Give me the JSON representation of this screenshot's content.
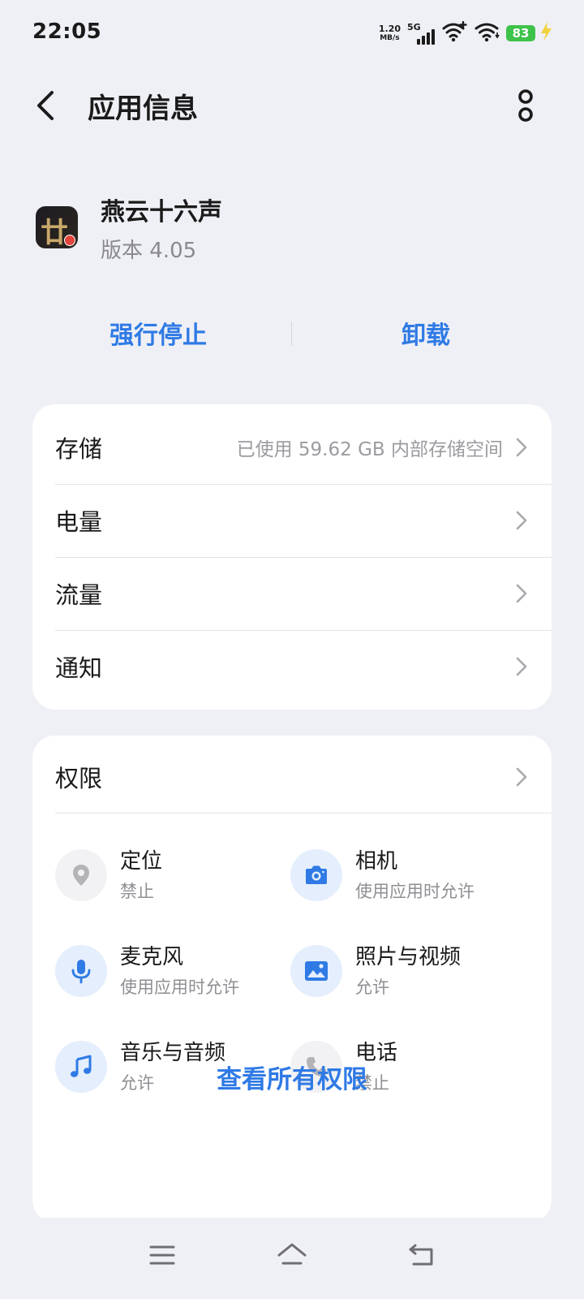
{
  "status_bar": {
    "time": "22:05",
    "net_speed_value": "1.20",
    "net_speed_unit": "MB/s",
    "network_type": "5G",
    "battery": "83",
    "charging": true
  },
  "header": {
    "title": "应用信息"
  },
  "app": {
    "name": "燕云十六声",
    "version": "版本 4.05",
    "icon_glyph": "廿"
  },
  "actions": {
    "force_stop": "强行停止",
    "uninstall": "卸载"
  },
  "settings_list": {
    "storage_label": "存储",
    "storage_value": "已使用 59.62 GB 内部存储空间",
    "battery_label": "电量",
    "data_label": "流量",
    "notification_label": "通知"
  },
  "permissions": {
    "title": "权限",
    "items": [
      {
        "name": "定位",
        "status": "禁止",
        "icon": "location-icon",
        "allowed": false
      },
      {
        "name": "相机",
        "status": "使用应用时允许",
        "icon": "camera-icon",
        "allowed": true
      },
      {
        "name": "麦克风",
        "status": "使用应用时允许",
        "icon": "microphone-icon",
        "allowed": true
      },
      {
        "name": "照片与视频",
        "status": "允许",
        "icon": "photo-icon",
        "allowed": true
      },
      {
        "name": "音乐与音频",
        "status": "允许",
        "icon": "music-icon",
        "allowed": true
      },
      {
        "name": "电话",
        "status": "禁止",
        "icon": "phone-icon",
        "allowed": false
      }
    ],
    "view_all": "查看所有权限"
  },
  "colors": {
    "accent": "#2f7ae5",
    "background": "#eff0f5",
    "battery": "#3ec24a",
    "icon_allowed": "#2f7ae5",
    "icon_denied": "#b4b4b8"
  }
}
